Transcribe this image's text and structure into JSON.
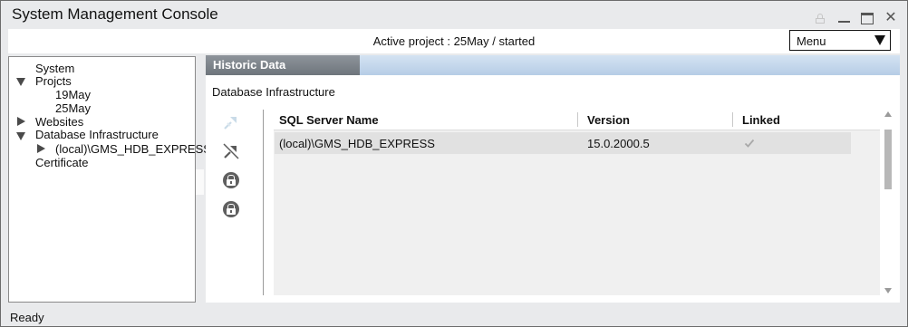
{
  "window": {
    "title": "System Management Console"
  },
  "project_bar": {
    "active_project": "Active project : 25May / started",
    "menu": {
      "selected": "Menu"
    }
  },
  "tree": {
    "items": [
      {
        "label": "System",
        "expander": "none"
      },
      {
        "label": "Projcts",
        "expander": "expanded"
      },
      {
        "label": "19May",
        "expander": "none"
      },
      {
        "label": "25May",
        "expander": "none"
      },
      {
        "label": "Websites",
        "expander": "collapsed"
      },
      {
        "label": "Database Infrastructure",
        "expander": "expanded"
      },
      {
        "label": "(local)\\GMS_HDB_EXPRESS",
        "expander": "collapsed"
      },
      {
        "label": "Certificate",
        "expander": "none"
      }
    ]
  },
  "panel": {
    "tab_label": "Historic Data",
    "section_title": "Database Infrastructure",
    "tools": [
      "link-icon",
      "unlink-icon",
      "lock-icon",
      "unlock-icon"
    ],
    "table": {
      "columns": [
        "SQL Server Name",
        "Version",
        "Linked"
      ],
      "rows": [
        {
          "name": "(local)\\GMS_HDB_EXPRESS",
          "version": "15.0.2000.5",
          "linked": true
        }
      ]
    }
  },
  "status": {
    "text": "Ready"
  },
  "colors": {
    "tab_bg": "#767d84",
    "tabstrip_bg": "#c3d7ec",
    "window_bg": "#e9eaec",
    "row_bg": "#e1e1e1"
  }
}
